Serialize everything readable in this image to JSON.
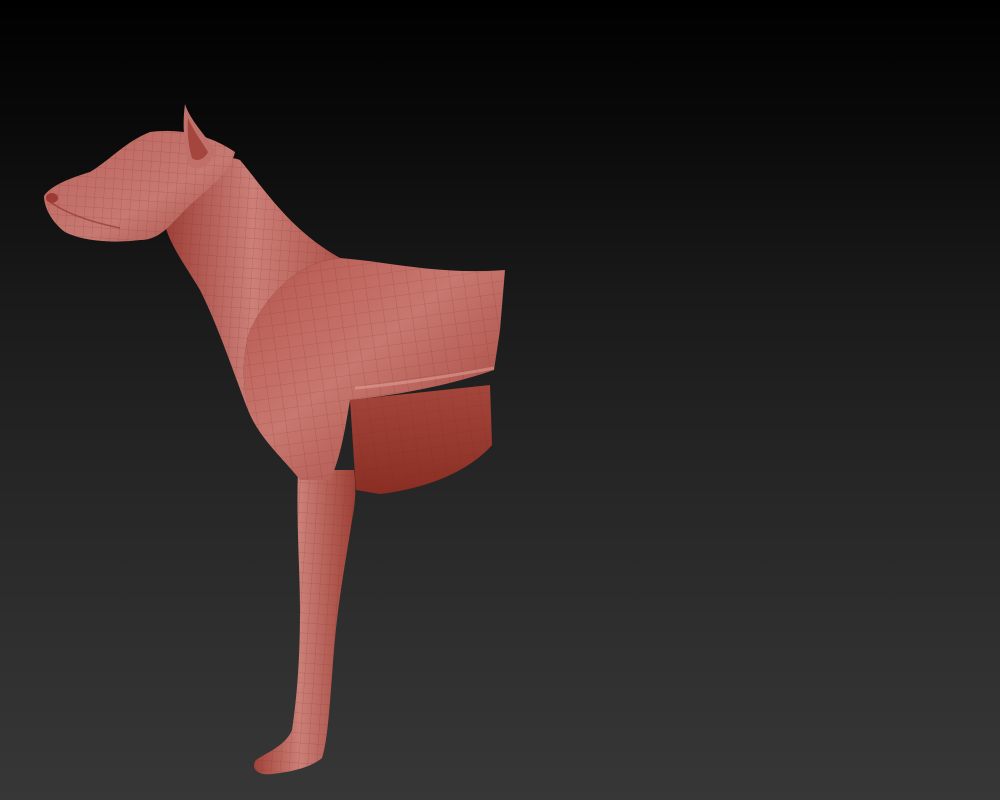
{
  "viewport": {
    "background_top": "#000000",
    "background_bottom": "#373737"
  },
  "model": {
    "subject": "dog-sculpt-partial",
    "material_color": "#b04a44",
    "highlight_color": "#d8908a",
    "shadow_color": "#8a2e26",
    "wireframe_visible": true
  }
}
